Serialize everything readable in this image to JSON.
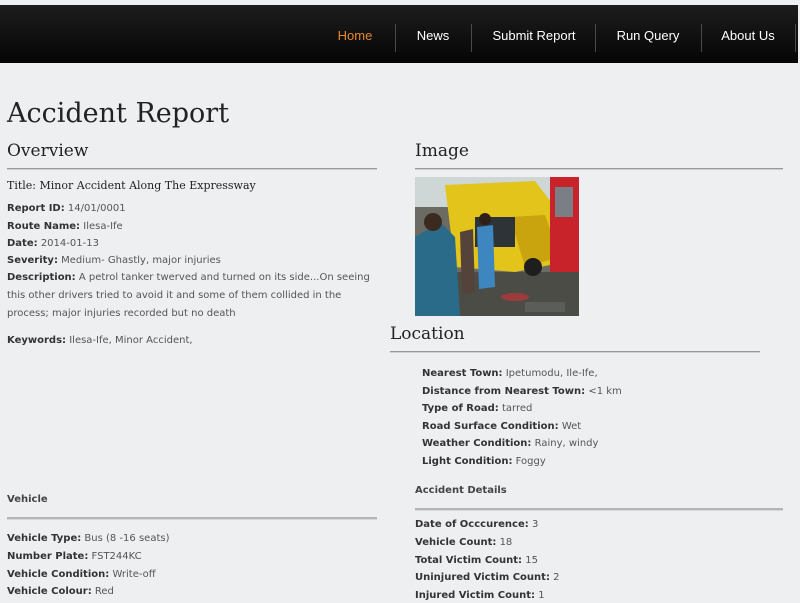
{
  "nav": {
    "items": [
      {
        "label": "Home",
        "active": true
      },
      {
        "label": "News"
      },
      {
        "label": "Submit Report"
      },
      {
        "label": "Run Query"
      },
      {
        "label": "About Us"
      }
    ],
    "active_color": "#e8872b"
  },
  "page": {
    "title": "Accident Report"
  },
  "overview": {
    "heading": "Overview",
    "report_title": "Title: Minor Accident Along The Expressway",
    "fields": [
      {
        "label": "Report ID:",
        "value": "14/01/0001"
      },
      {
        "label": "Route Name:",
        "value": "Ilesa-Ife"
      },
      {
        "label": "Date:",
        "value": "2014-01-13"
      },
      {
        "label": "Severity:",
        "value": "Medium- Ghastly, major injuries"
      }
    ],
    "description": {
      "label": "Description:",
      "value": "A petrol tanker twerved and turned on its side...On seeing this other drivers tried to avoid it and some of them collided in the process; major injuries recorded but no death"
    },
    "keywords": {
      "label": "Keywords:",
      "value": "Ilesa-Ife, Minor Accident,"
    }
  },
  "image_section": {
    "heading": "Image",
    "image_icon": "accident-photo"
  },
  "location": {
    "heading": "Location",
    "fields": [
      {
        "label": "Nearest Town:",
        "value": "Ipetumodu, Ile-Ife,"
      },
      {
        "label": "Distance from Nearest Town:",
        "value": "<1 km"
      },
      {
        "label": "Type of Road:",
        "value": "tarred"
      },
      {
        "label": "Road Surface Condition:",
        "value": "Wet"
      },
      {
        "label": "Weather Condition:",
        "value": "Rainy, windy"
      },
      {
        "label": "Light Condition:",
        "value": "Foggy"
      }
    ]
  },
  "vehicle": {
    "heading": "Vehicle",
    "fields": [
      {
        "label": "Vehicle Type:",
        "value": "Bus (8 -16 seats)"
      },
      {
        "label": "Number Plate:",
        "value": "FST244KC"
      },
      {
        "label": "Vehicle Condition:",
        "value": "Write-off"
      },
      {
        "label": "Vehicle Colour:",
        "value": "Red"
      }
    ]
  },
  "accident_details": {
    "heading": "Accident Details",
    "fields": [
      {
        "label": "Date of Occcurence:",
        "value": "3"
      },
      {
        "label": "Vehicle Count:",
        "value": "18"
      },
      {
        "label": "Total Victim Count:",
        "value": "15"
      },
      {
        "label": "Uninjured Victim Count:",
        "value": "2"
      },
      {
        "label": "Injured Victim Count:",
        "value": "1"
      }
    ]
  }
}
